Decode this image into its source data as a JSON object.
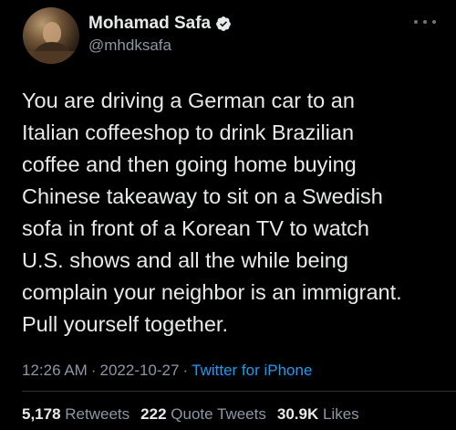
{
  "author": {
    "display_name": "Mohamad Safa",
    "handle": "@mhdksafa",
    "verified": true
  },
  "tweet": {
    "text": "You are driving a German car to an\nItalian coffeeshop to drink Brazilian\ncoffee and then going home buying\nChinese takeaway to sit on a Swedish\nsofa in front of a Korean TV to watch\nU.S. shows and all the while being\ncomplain your neighbor is an immigrant.\nPull yourself together.",
    "time": "12:26 AM",
    "date": "2022-10-27",
    "separator": "·",
    "source": "Twitter for iPhone"
  },
  "stats": {
    "retweets_count": "5,178",
    "retweets_label": "Retweets",
    "quote_tweets_count": "222",
    "quote_tweets_label": "Quote Tweets",
    "likes_count": "30.9K",
    "likes_label": "Likes"
  },
  "icons": {
    "verified": "verified-badge-icon",
    "more": "more-options-icon"
  },
  "colors": {
    "background": "#000000",
    "text_primary": "#e7e9ea",
    "text_secondary": "#8b98a5",
    "link": "#1d9bf0",
    "divider": "#2f3336"
  }
}
